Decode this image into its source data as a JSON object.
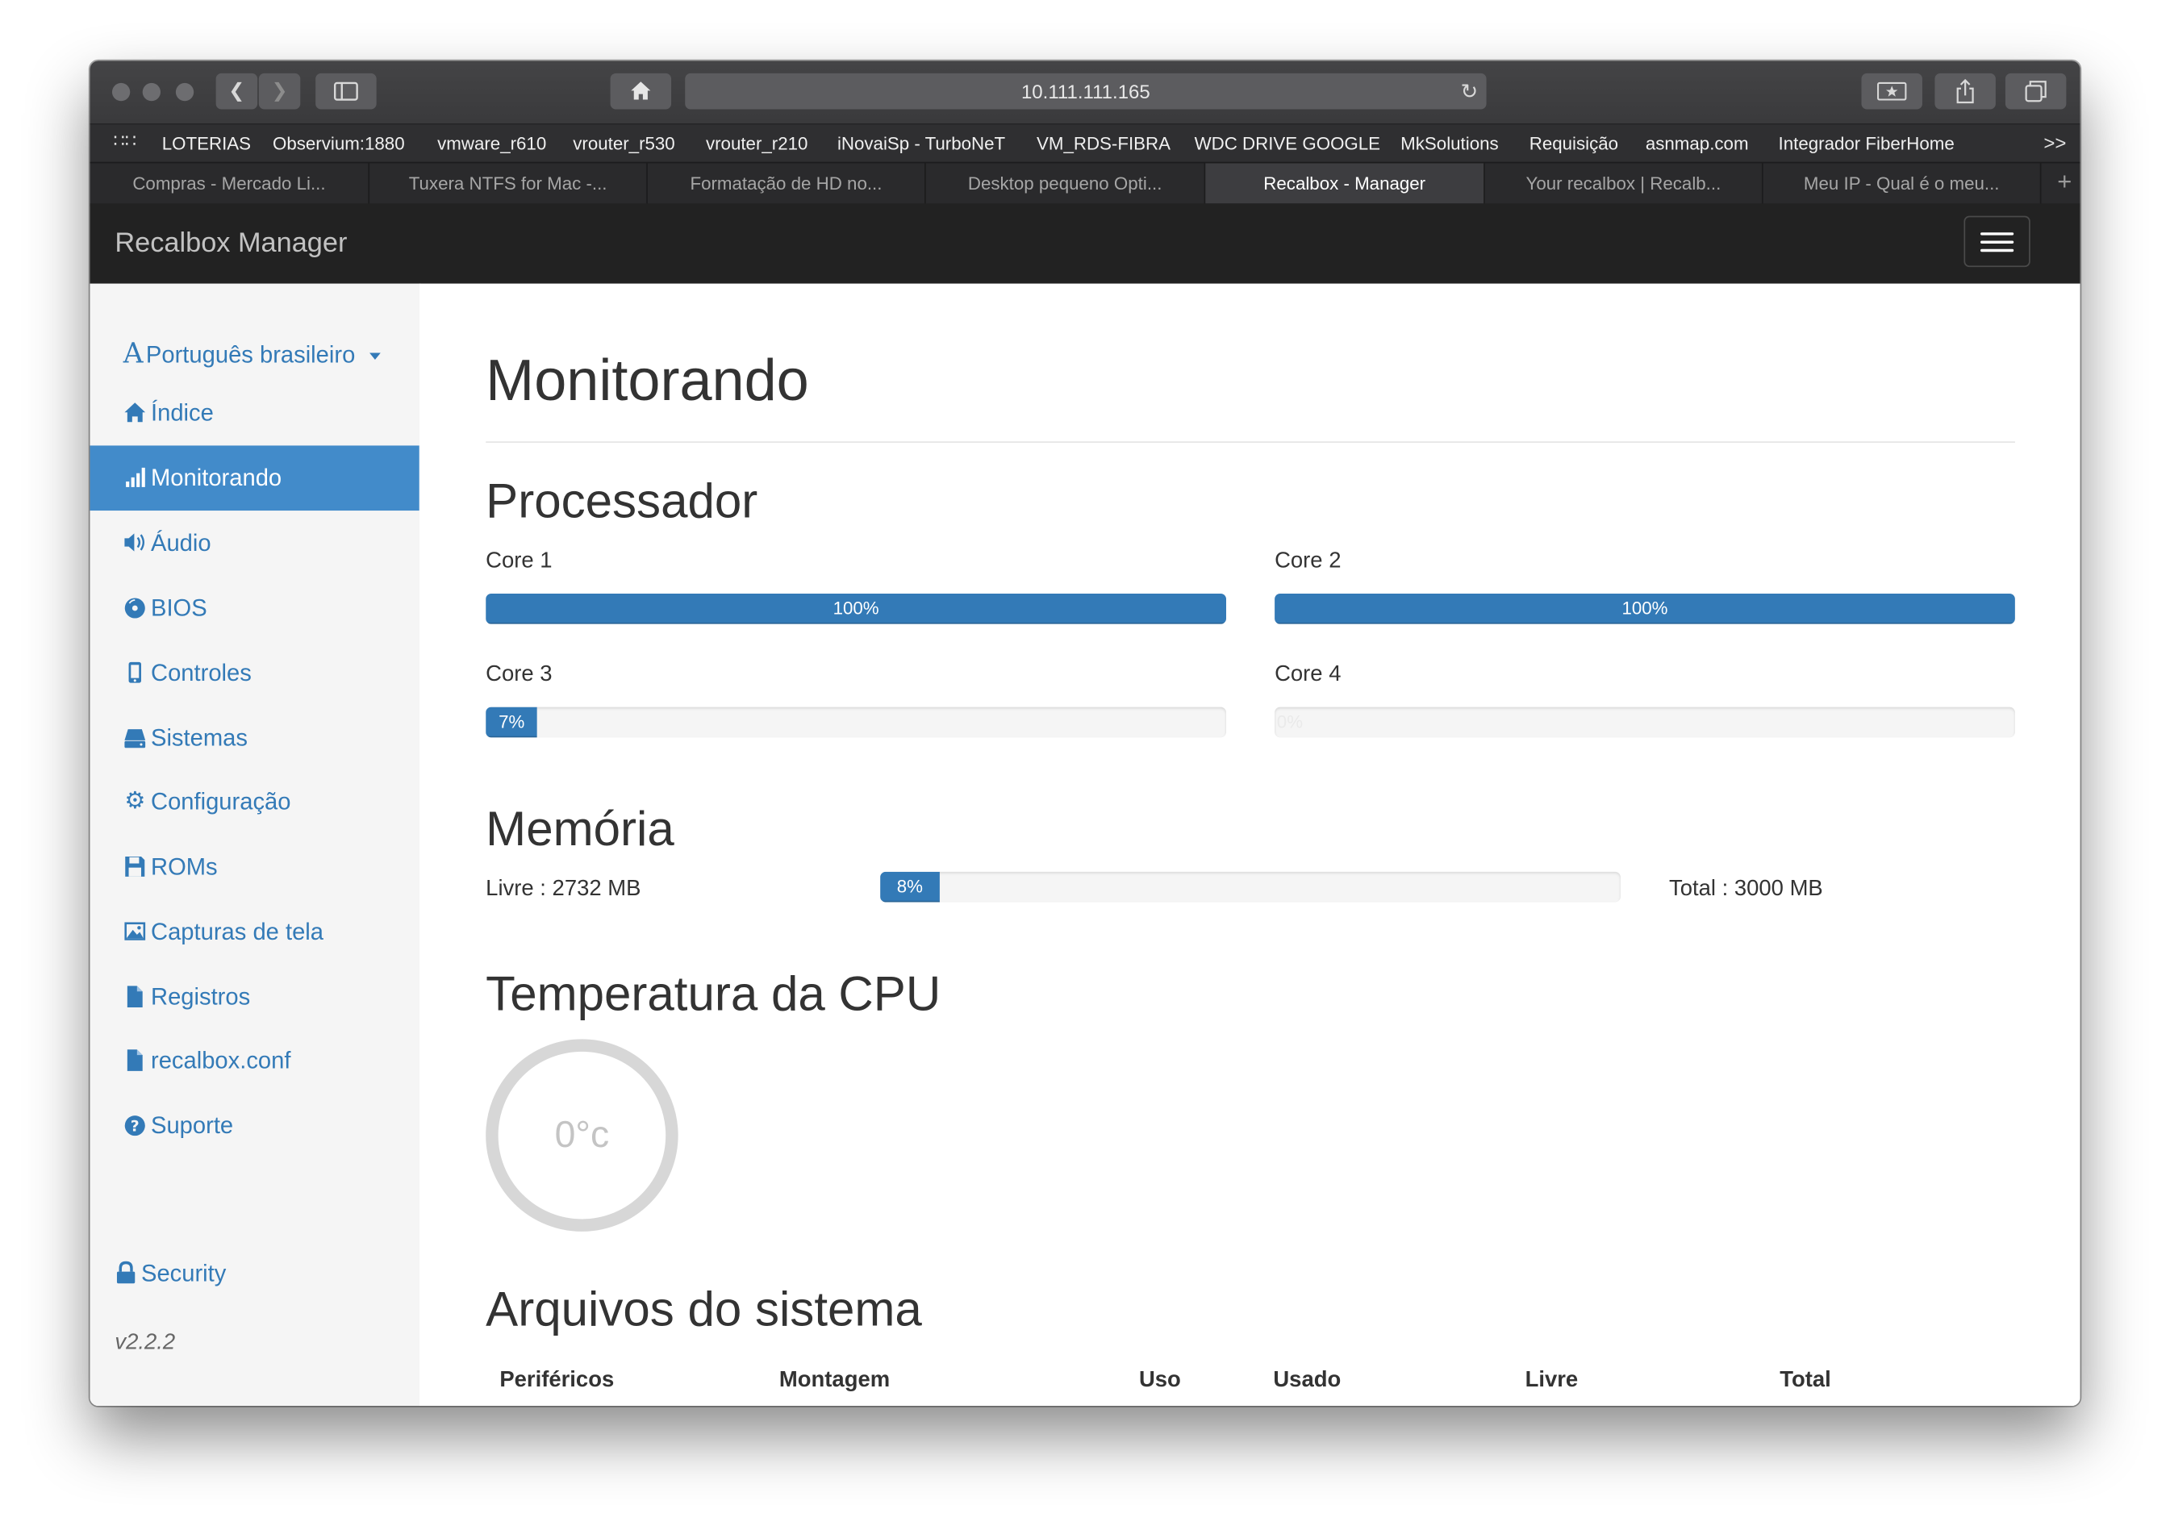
{
  "browser": {
    "url": "10.111.111.165",
    "bookmarks": [
      "LOTERIAS",
      "Observium:1880",
      "vmware_r610",
      "vrouter_r530",
      "vrouter_r210",
      "iNovaiSp - TurboNeT",
      "VM_RDS-FIBRA",
      "WDC DRIVE GOOGLE",
      "MkSolutions",
      "Requisição",
      "asnmap.com",
      "Integrador FiberHome"
    ],
    "bookmarks_more": ">>",
    "tabs": [
      {
        "label": "Compras - Mercado Li...",
        "active": false
      },
      {
        "label": "Tuxera NTFS for Mac -...",
        "active": false
      },
      {
        "label": "Formatação de HD no...",
        "active": false
      },
      {
        "label": "Desktop pequeno Opti...",
        "active": false
      },
      {
        "label": "Recalbox - Manager",
        "active": true
      },
      {
        "label": "Your recalbox | Recalb...",
        "active": false
      },
      {
        "label": "Meu IP - Qual é o meu...",
        "active": false
      }
    ]
  },
  "navbar": {
    "brand": "Recalbox Manager"
  },
  "sidebar": {
    "language": "Português brasileiro",
    "items": [
      {
        "label": "Índice",
        "icon": "home-icon",
        "active": false
      },
      {
        "label": "Monitorando",
        "icon": "signal-icon",
        "active": true
      },
      {
        "label": "Áudio",
        "icon": "volume-icon",
        "active": false
      },
      {
        "label": "BIOS",
        "icon": "cd-icon",
        "active": false
      },
      {
        "label": "Controles",
        "icon": "phone-icon",
        "active": false
      },
      {
        "label": "Sistemas",
        "icon": "hdd-icon",
        "active": false
      },
      {
        "label": "Configuração",
        "icon": "cog-icon",
        "active": false
      },
      {
        "label": "ROMs",
        "icon": "floppy-icon",
        "active": false
      },
      {
        "label": "Capturas de tela",
        "icon": "picture-icon",
        "active": false
      },
      {
        "label": "Registros",
        "icon": "file-icon",
        "active": false
      },
      {
        "label": "recalbox.conf",
        "icon": "file-icon",
        "active": false
      },
      {
        "label": "Suporte",
        "icon": "question-icon",
        "active": false
      }
    ],
    "security": "Security",
    "version": "v2.2.2"
  },
  "main": {
    "title": "Monitorando",
    "processor": {
      "heading": "Processador",
      "cores": [
        {
          "label": "Core 1",
          "percent": 100,
          "text": "100%"
        },
        {
          "label": "Core 2",
          "percent": 100,
          "text": "100%"
        },
        {
          "label": "Core 3",
          "percent": 7,
          "text": "7%"
        },
        {
          "label": "Core 4",
          "percent": 0,
          "text": "0%"
        }
      ]
    },
    "memory": {
      "heading": "Memória",
      "free": "Livre : 2732 MB",
      "percent": 8,
      "text": "8%",
      "total": "Total : 3000 MB"
    },
    "cpu_temp": {
      "heading": "Temperatura da CPU",
      "value": "0°c"
    },
    "filesystems": {
      "heading": "Arquivos do sistema",
      "columns": [
        "Periféricos",
        "Montagem",
        "Uso",
        "Usado",
        "Livre",
        "Total"
      ]
    }
  }
}
